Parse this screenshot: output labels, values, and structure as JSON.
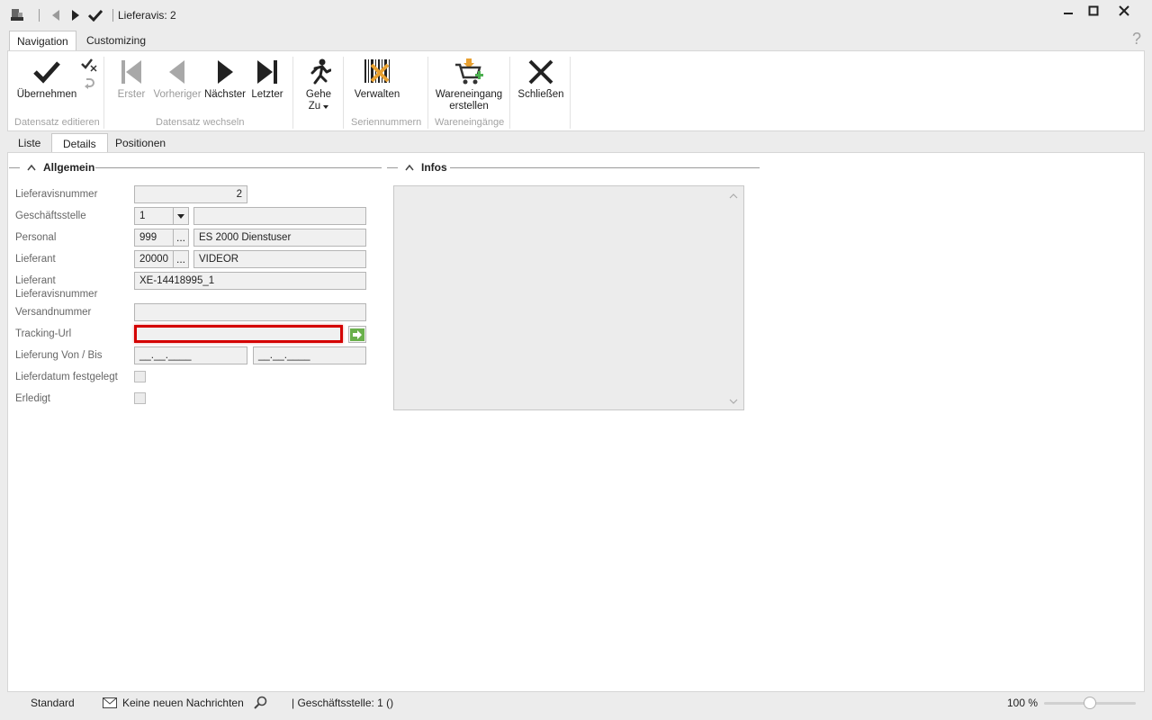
{
  "window": {
    "title": "Lieferavis: 2"
  },
  "ribbon_tabs": [
    {
      "label": "Navigation",
      "active": true
    },
    {
      "label": "Customizing",
      "active": false
    }
  ],
  "help_label": "?",
  "ribbon": {
    "buttons": {
      "uebernehmen": "Übernehmen",
      "erster": "Erster",
      "vorheriger": "Vorheriger",
      "naechster": "Nächster",
      "letzter": "Letzter",
      "gehe_line1": "Gehe",
      "gehe_line2": "Zu",
      "verwalten": "Verwalten",
      "wareneingang_line1": "Wareneingang",
      "wareneingang_line2": "erstellen",
      "schliessen": "Schließen"
    },
    "groups": {
      "datensatz_editieren": "Datensatz editieren",
      "datensatz_wechseln": "Datensatz wechseln",
      "seriennummern": "Seriennummern",
      "wareneingaenge": "Wareneingänge"
    }
  },
  "doc_tabs": [
    {
      "label": "Liste",
      "active": false
    },
    {
      "label": "Details",
      "active": true
    },
    {
      "label": "Positionen",
      "active": false
    }
  ],
  "sections": {
    "allgemein": "Allgemein",
    "infos": "Infos"
  },
  "form": {
    "lieferavisnummer": {
      "label": "Lieferavisnummer",
      "value": "2"
    },
    "geschaeftsstelle": {
      "label": "Geschäftsstelle",
      "value": "1",
      "description": ""
    },
    "personal": {
      "label": "Personal",
      "value": "999",
      "description": "ES 2000 Dienstuser"
    },
    "lieferant": {
      "label": "Lieferant",
      "value": "20000",
      "description": "VIDEOR"
    },
    "lieferant_lieferavisnummer": {
      "label_line1": "Lieferant",
      "label_line2": "Lieferavisnummer",
      "value": "XE-14418995_1"
    },
    "versandnummer": {
      "label": "Versandnummer",
      "value": ""
    },
    "tracking_url": {
      "label": "Tracking-Url",
      "value": ""
    },
    "lieferung_von_bis": {
      "label": "Lieferung Von / Bis",
      "von": "__.__.____",
      "bis": "__.__.____"
    },
    "lieferdatum_festgelegt": {
      "label": "Lieferdatum festgelegt",
      "checked": false
    },
    "erledigt": {
      "label": "Erledigt",
      "checked": false
    }
  },
  "ellipsis": "...",
  "statusbar": {
    "layout": "Standard",
    "messages": "Keine neuen Nachrichten",
    "branch": "| Geschäftsstelle:  1 ()",
    "zoom": "100 %",
    "zoom_level": 0.5
  },
  "colors": {
    "highlight_border": "#d40000",
    "go_button": "#6ab04c"
  }
}
